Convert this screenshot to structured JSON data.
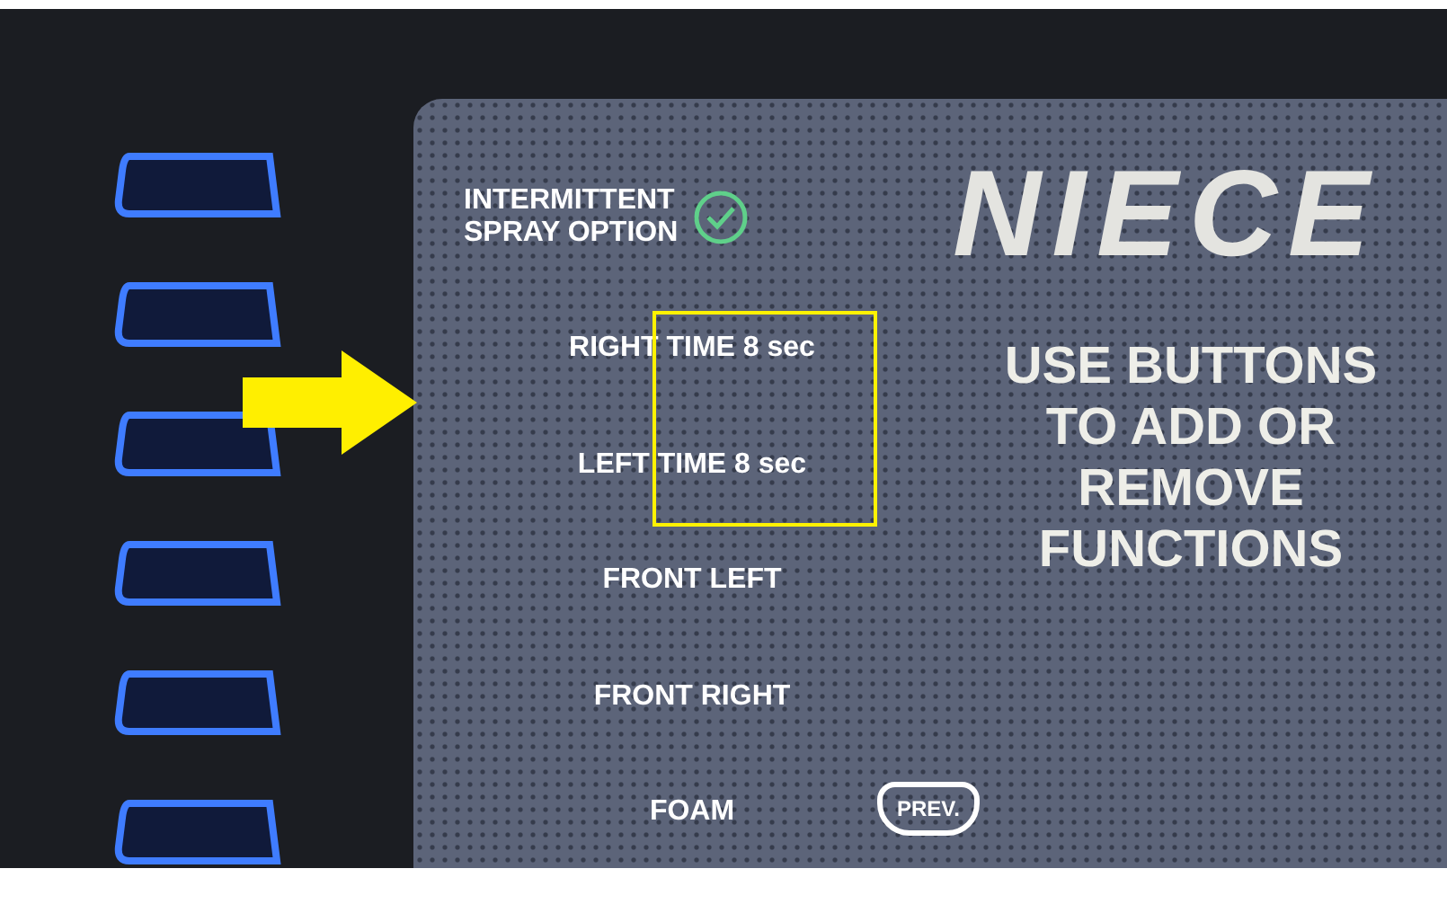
{
  "menu_items": [
    {
      "label": "INTERMITTENT\nSPRAY OPTION",
      "checked": true
    },
    {
      "label": "RIGHT TIME 8 sec",
      "checked": false
    },
    {
      "label": "LEFT TIME 8 sec",
      "checked": false
    },
    {
      "label": "FRONT LEFT",
      "checked": false
    },
    {
      "label": "FRONT RIGHT",
      "checked": false
    },
    {
      "label": "FOAM",
      "checked": false
    }
  ],
  "logo": "NIECE",
  "message": "USE BUTTONS\nTO ADD OR\nREMOVE\nFUNCTIONS",
  "prev_button": "PREV."
}
